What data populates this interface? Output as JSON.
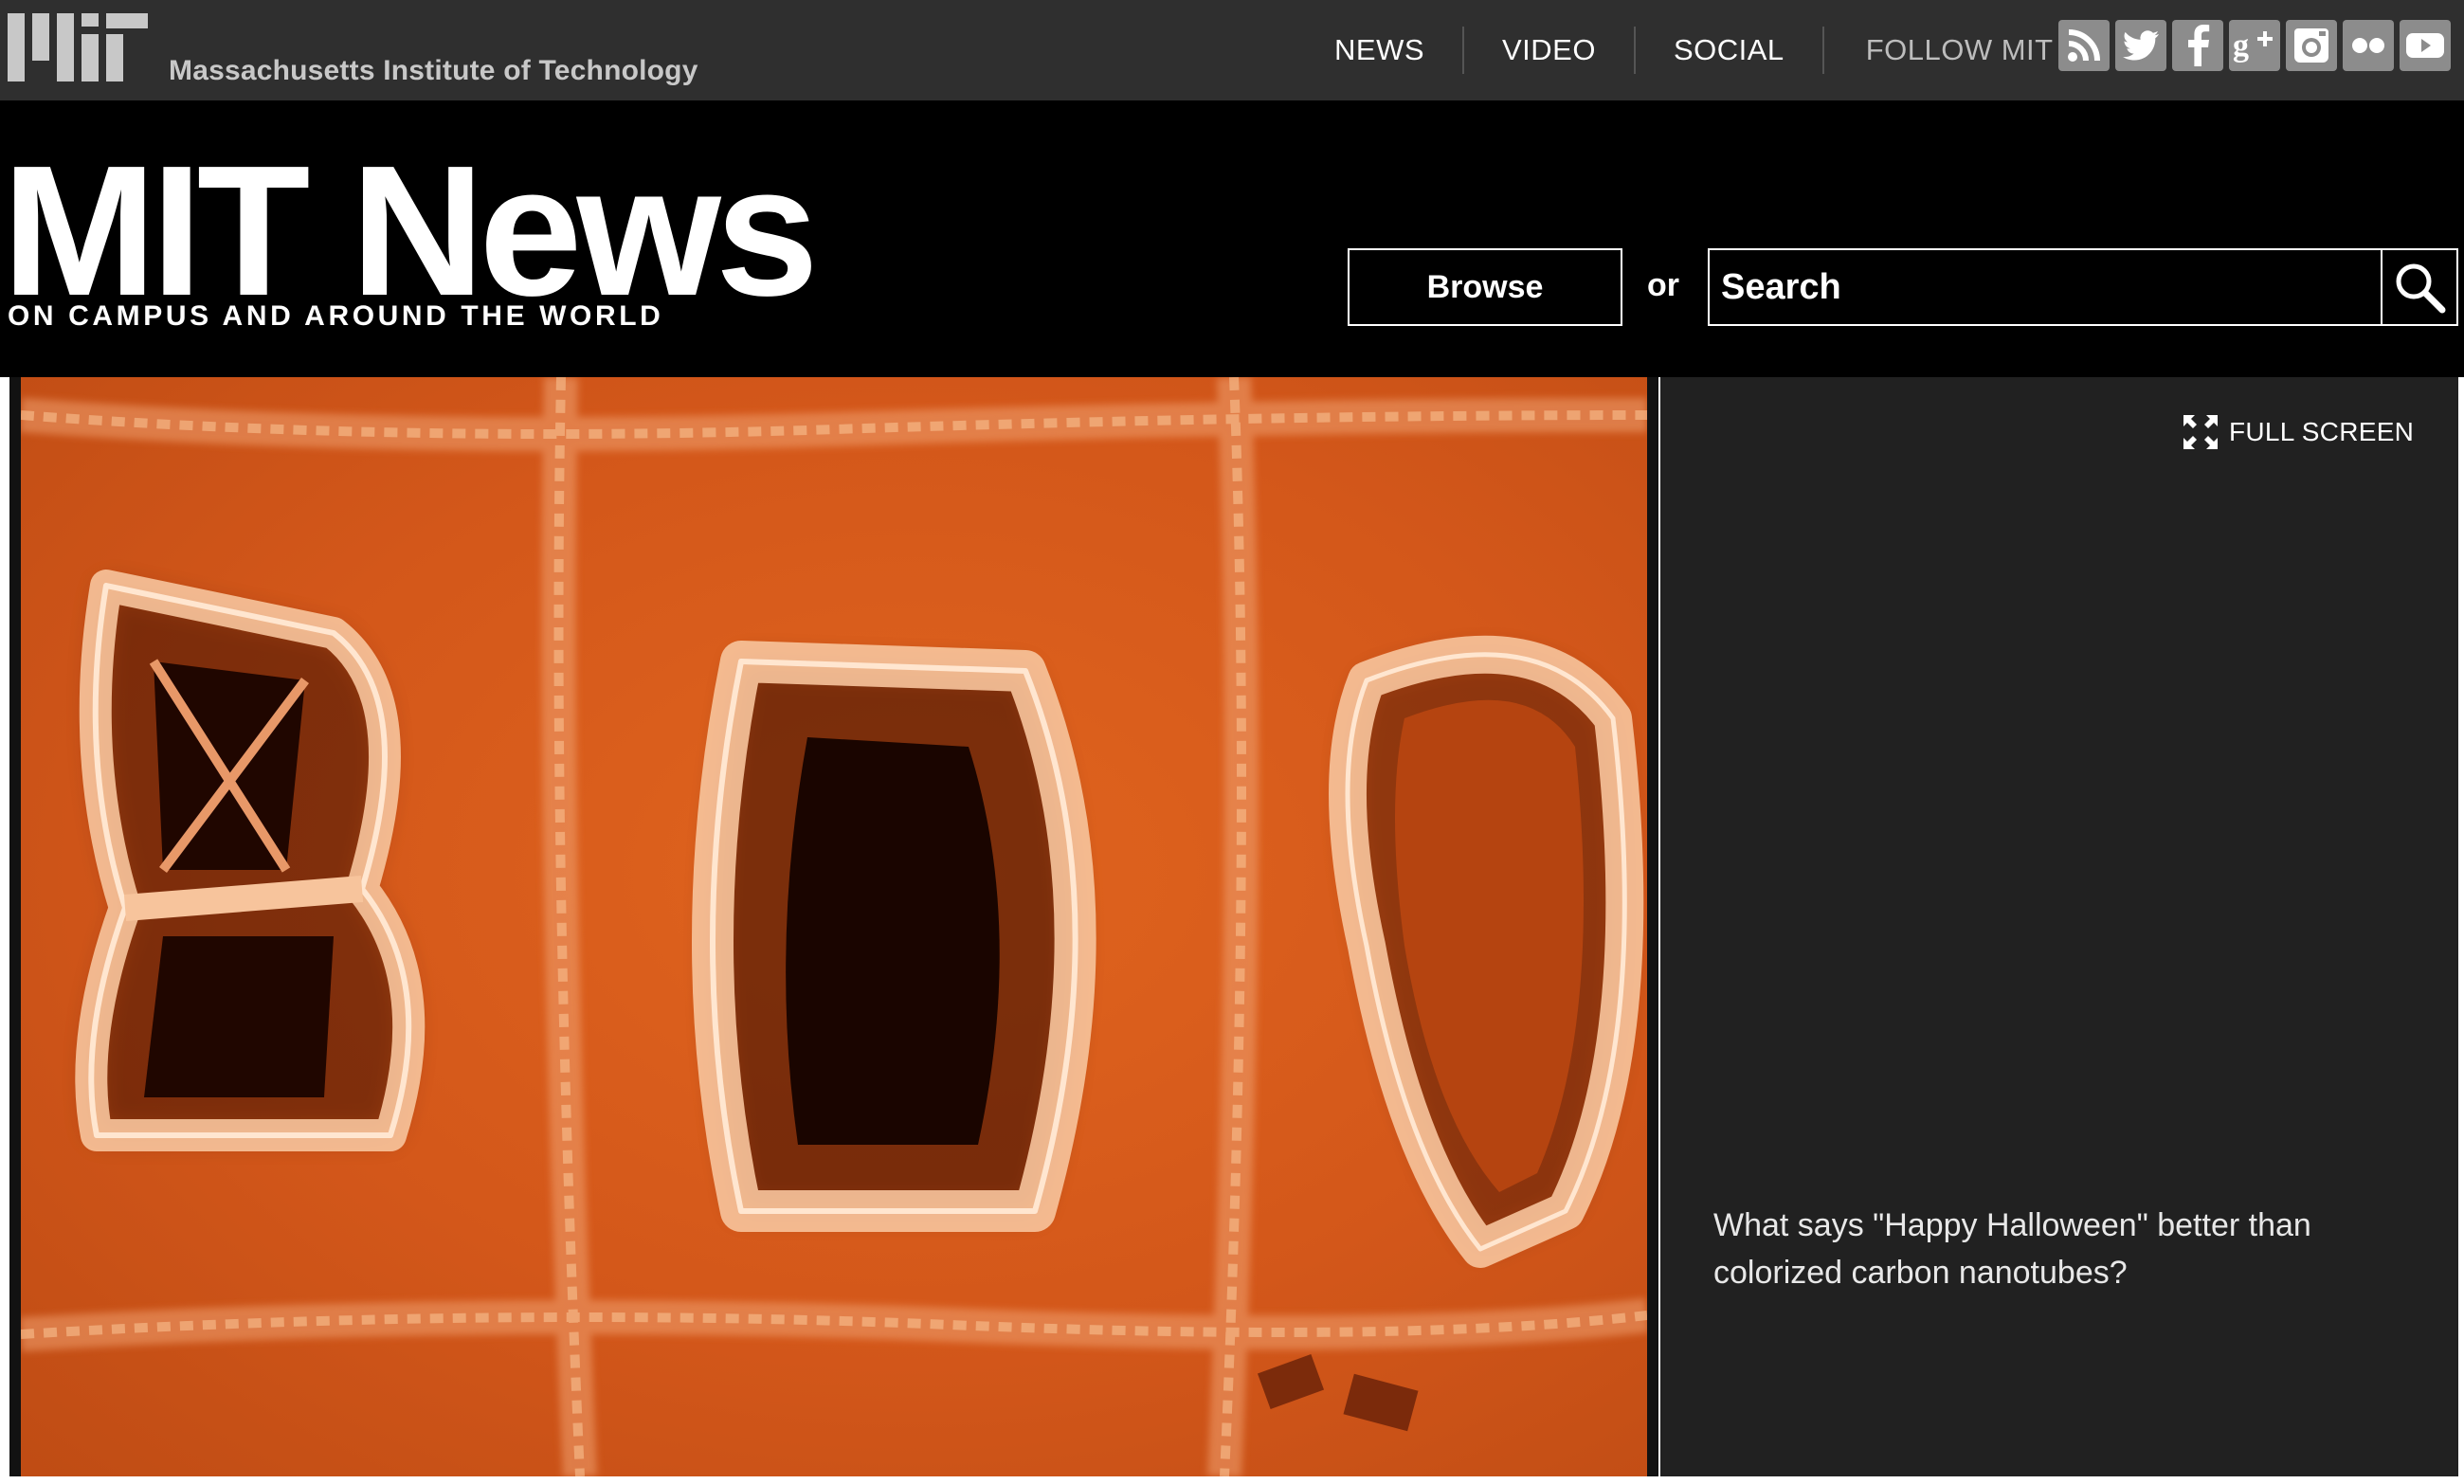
{
  "header": {
    "institute_name": "Massachusetts Institute of Technology",
    "nav": [
      "NEWS",
      "VIDEO",
      "SOCIAL"
    ],
    "follow_label": "FOLLOW MIT",
    "social_icons": [
      "rss-icon",
      "twitter-icon",
      "facebook-icon",
      "google-plus-icon",
      "instagram-icon",
      "flickr-icon",
      "youtube-icon"
    ]
  },
  "masthead": {
    "title": "MIT News",
    "tagline": "ON CAMPUS AND AROUND THE WORLD",
    "browse_label": "Browse",
    "or_label": "or",
    "search_placeholder": "Search"
  },
  "gallery": {
    "fullscreen_label": "FULL SCREEN",
    "caption": "What says \"Happy Halloween\" better than colorized carbon nanotubes?"
  },
  "colors": {
    "topbar": "#2f2f2f",
    "masthead": "#000000",
    "caption_panel": "#212121",
    "image_orange": "#d85b1c"
  }
}
